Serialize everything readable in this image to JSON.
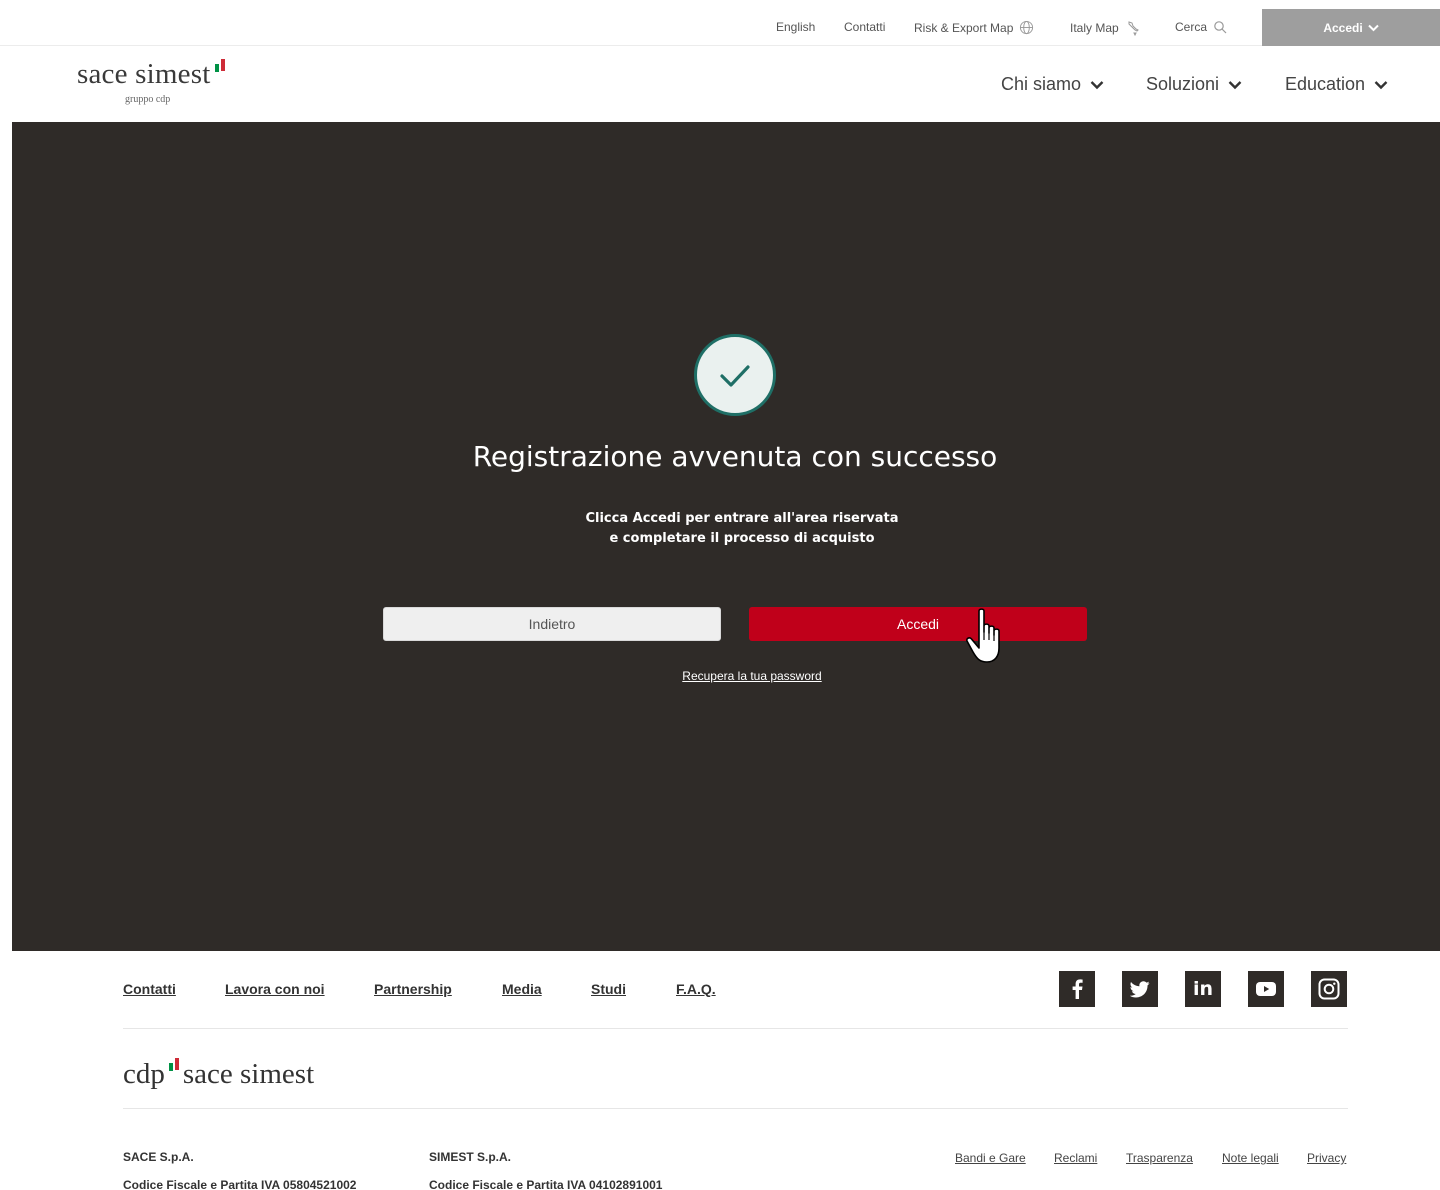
{
  "topbar": {
    "english": "English",
    "contatti": "Contatti",
    "risk_map": "Risk & Export Map",
    "italy_map": "Italy Map",
    "cerca": "Cerca",
    "accedi": "Accedi"
  },
  "header": {
    "logo_main": "sace simest",
    "logo_sub": "gruppo cdp",
    "nav": [
      "Chi siamo",
      "Soluzioni",
      "Education"
    ]
  },
  "hero": {
    "title": "Registrazione avvenuta con successo",
    "subtitle_line1": "Clicca Accedi per entrare all'area riservata",
    "subtitle_line2": "e completare il processo di acquisto",
    "back_button": "Indietro",
    "login_button": "Accedi",
    "recover_link": "Recupera la tua password"
  },
  "footer": {
    "links": [
      "Contatti",
      "Lavora con noi",
      "Partnership",
      "Media",
      "Studi",
      "F.A.Q."
    ],
    "social_icons": [
      "facebook-icon",
      "twitter-icon",
      "linkedin-icon",
      "youtube-icon",
      "instagram-icon"
    ],
    "logo_left": "cdp",
    "logo_right": "sace simest",
    "sace_name": "SACE S.p.A.",
    "sace_cf": "Codice Fiscale e Partita IVA 05804521002",
    "simest_name": "SIMEST S.p.A.",
    "simest_cf": "Codice Fiscale e Partita IVA 04102891001",
    "legal_links": [
      "Bandi e Gare",
      "Reclami",
      "Trasparenza",
      "Note legali",
      "Privacy"
    ]
  },
  "colors": {
    "hero_bg": "#2f2b28",
    "accent_red": "#c0001a",
    "check_green": "#1f6f66",
    "top_accedi_bg": "#9e9e9e"
  }
}
